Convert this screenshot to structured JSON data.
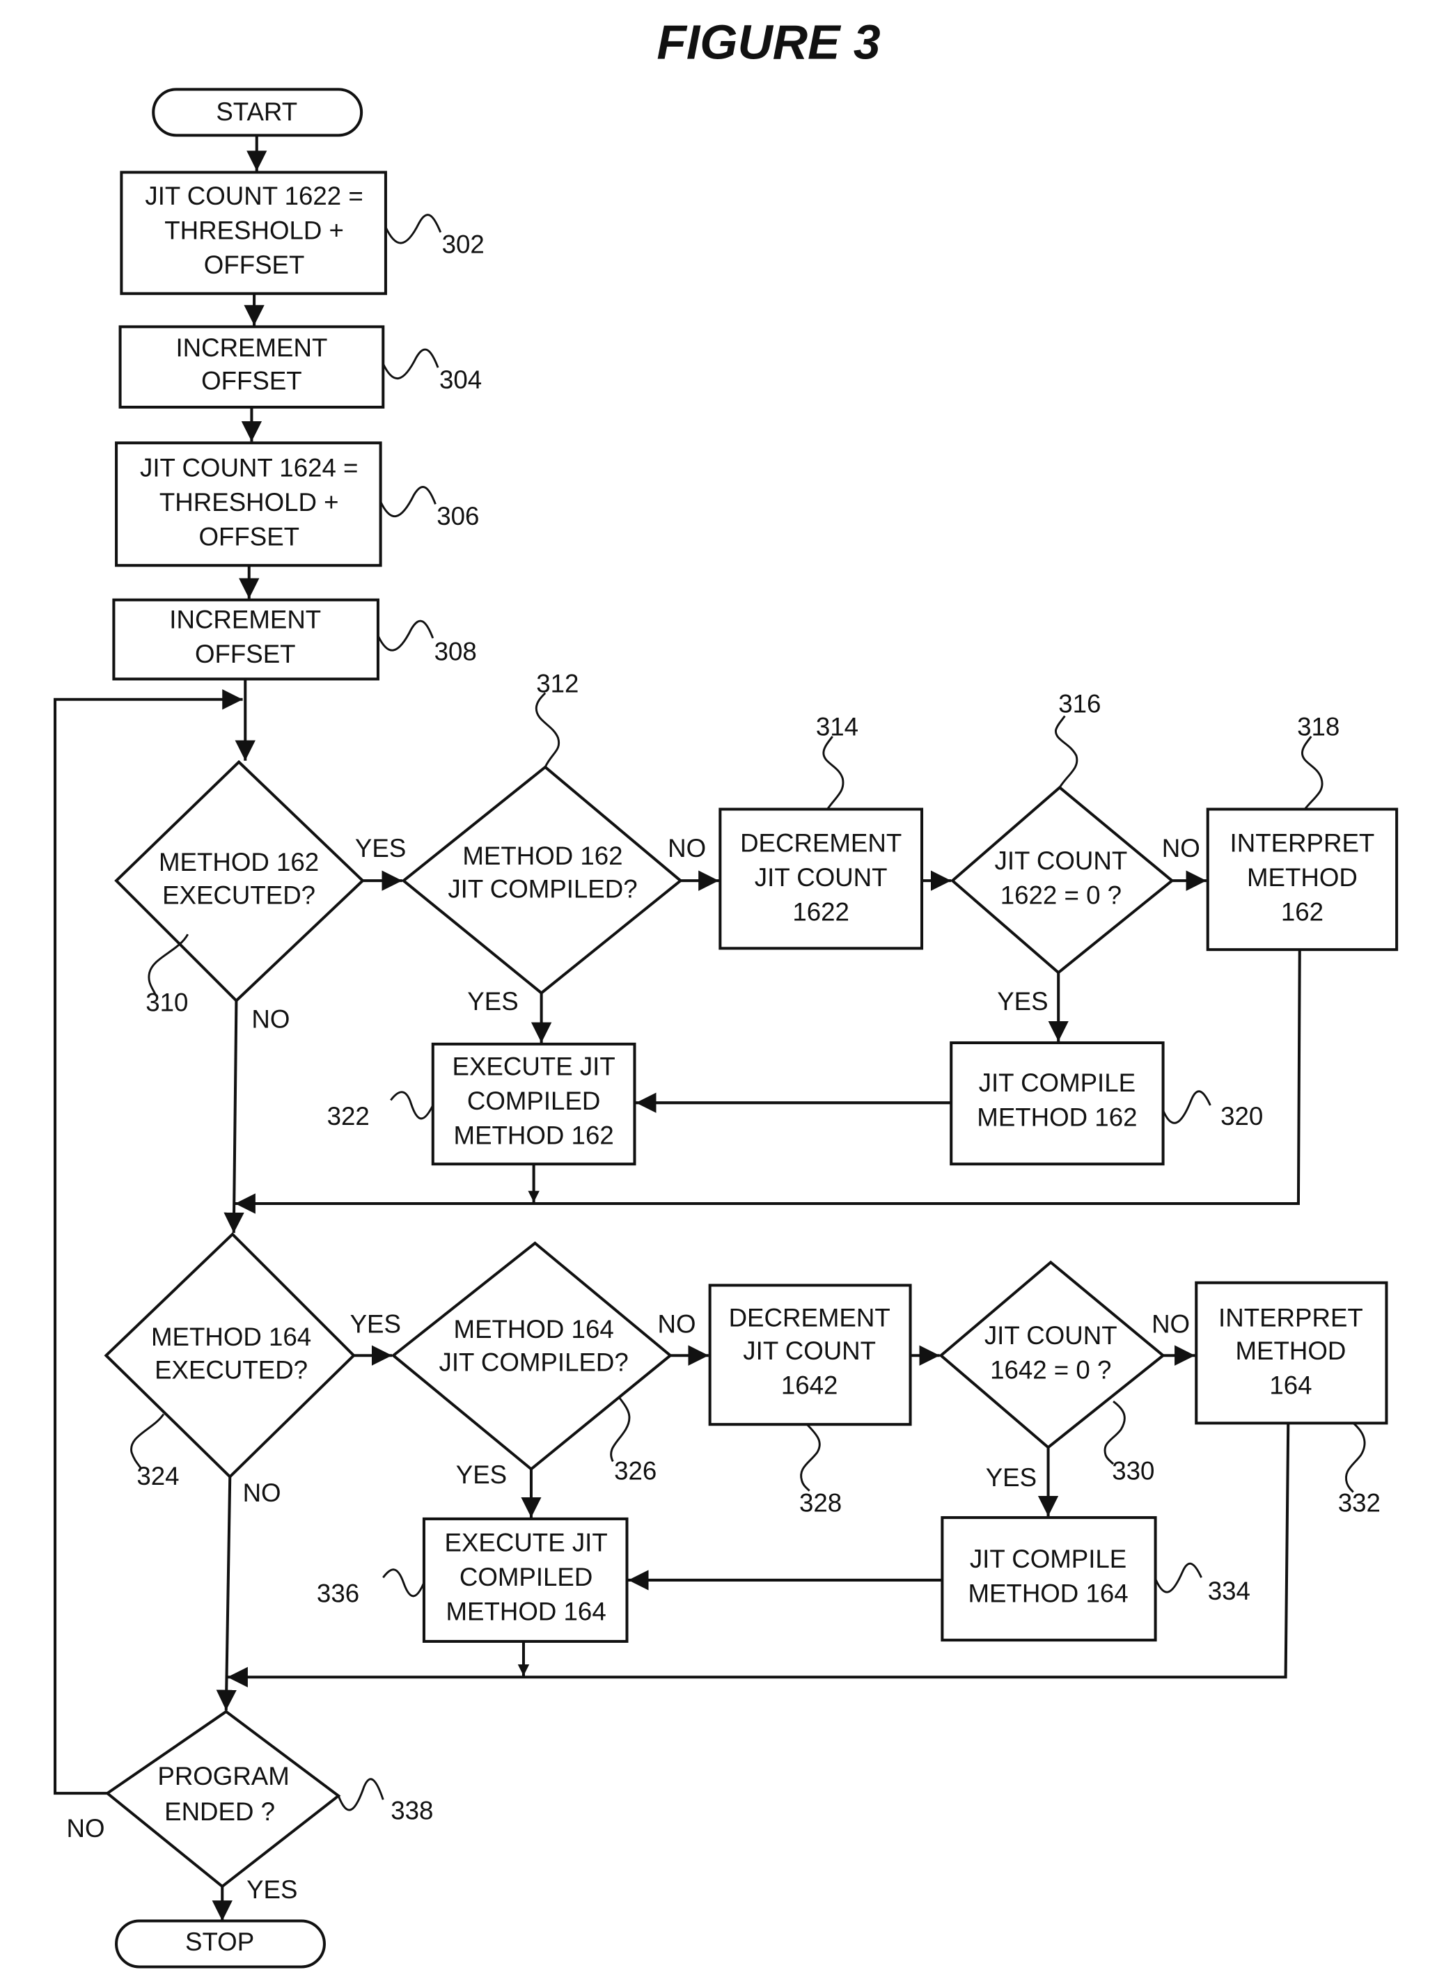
{
  "figure": {
    "title": "FIGURE 3"
  },
  "terminals": {
    "start": "START",
    "stop": "STOP"
  },
  "steps": {
    "s302": {
      "lines": [
        "JIT COUNT 1622 =",
        "THRESHOLD +",
        "OFFSET"
      ],
      "ref": "302"
    },
    "s304": {
      "lines": [
        "INCREMENT",
        "OFFSET"
      ],
      "ref": "304"
    },
    "s306": {
      "lines": [
        "JIT COUNT 1624 =",
        "THRESHOLD +",
        "OFFSET"
      ],
      "ref": "306"
    },
    "s308": {
      "lines": [
        "INCREMENT",
        "OFFSET"
      ],
      "ref": "308"
    },
    "d310": {
      "lines": [
        "METHOD 162",
        "EXECUTED?"
      ],
      "ref": "310"
    },
    "d312": {
      "lines": [
        "METHOD 162",
        "JIT COMPILED?"
      ],
      "ref": "312"
    },
    "s314": {
      "lines": [
        "DECREMENT",
        "JIT COUNT",
        "1622"
      ],
      "ref": "314"
    },
    "d316": {
      "lines": [
        "JIT COUNT",
        "1622 = 0 ?"
      ],
      "ref": "316"
    },
    "s318": {
      "lines": [
        "INTERPRET",
        "METHOD",
        "162"
      ],
      "ref": "318"
    },
    "s320": {
      "lines": [
        "JIT COMPILE",
        "METHOD 162"
      ],
      "ref": "320"
    },
    "s322": {
      "lines": [
        "EXECUTE JIT",
        "COMPILED",
        "METHOD 162"
      ],
      "ref": "322"
    },
    "d324": {
      "lines": [
        "METHOD 164",
        "EXECUTED?"
      ],
      "ref": "324"
    },
    "d326": {
      "lines": [
        "METHOD 164",
        "JIT COMPILED?"
      ],
      "ref": "326"
    },
    "s328": {
      "lines": [
        "DECREMENT",
        "JIT COUNT",
        "1642"
      ],
      "ref": "328"
    },
    "d330": {
      "lines": [
        "JIT COUNT",
        "1642 = 0 ?"
      ],
      "ref": "330"
    },
    "s332": {
      "lines": [
        "INTERPRET",
        "METHOD",
        "164"
      ],
      "ref": "332"
    },
    "s334": {
      "lines": [
        "JIT COMPILE",
        "METHOD 164"
      ],
      "ref": "334"
    },
    "s336": {
      "lines": [
        "EXECUTE JIT",
        "COMPILED",
        "METHOD 164"
      ],
      "ref": "336"
    },
    "d338": {
      "lines": [
        "PROGRAM",
        "ENDED ?"
      ],
      "ref": "338"
    }
  },
  "edge_labels": {
    "yes": "YES",
    "no": "NO"
  }
}
